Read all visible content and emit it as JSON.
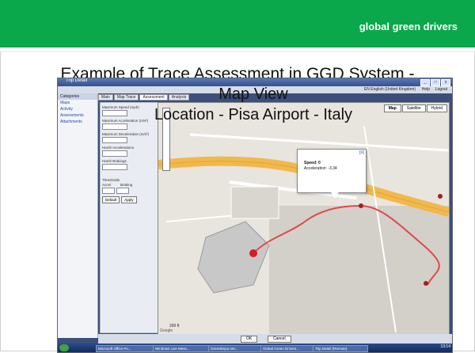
{
  "header": {
    "brand": "global green drivers",
    "color": "#0aa84a"
  },
  "slide": {
    "title_line1": "Example of Trace Assessment in GGD System -",
    "title_line2": "Map View",
    "subtitle": "Location - Pisa Airport - Italy"
  },
  "window": {
    "title": "Trip Detail",
    "language": "EN English (United Kingdom)",
    "help": "Help",
    "logout": "Logout",
    "brand_tag": "trip"
  },
  "nav": {
    "header": "Categories",
    "items": [
      "Maps",
      "Activity",
      "Assessments",
      "Attachments"
    ]
  },
  "tabs": [
    "Main",
    "Map Trace",
    "Assessment",
    "Analysis"
  ],
  "form": {
    "labels": [
      "Maximum Speed (mph)",
      "Maximum Acceleration (m/s²)",
      "Maximum Deceleration (m/s²)",
      "Harsh Accelerations",
      "Harsh Brakings"
    ],
    "thresholds_label": "Thresholds",
    "accel_label": "Accel",
    "braking_label": "Braking",
    "default_button": "Default",
    "apply_button": "Apply"
  },
  "map": {
    "tabs": [
      "Map",
      "Satellite",
      "Hybrid"
    ],
    "active_tab": "Map",
    "scale": "200 ft",
    "logo": "Google",
    "popup": {
      "close": "[X]",
      "speed": "Speed: 0",
      "acceleration": "Acceleration: -3.34"
    }
  },
  "buttons": {
    "ok": "OK",
    "cancel": "Cancel"
  },
  "taskbar": {
    "items": [
      "Microsoft Office Po...",
      "Windows Live Mess...",
      "Greenlimpo.net...",
      "Global Green Drivers...",
      "Trip Detail (Remote)"
    ],
    "time": "13:14"
  }
}
